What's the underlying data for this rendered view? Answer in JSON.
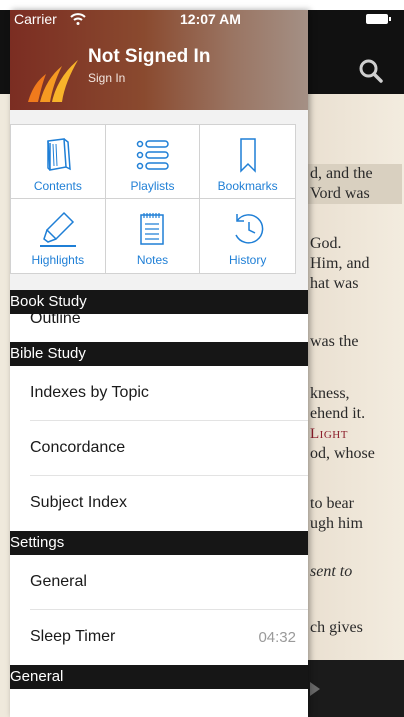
{
  "status_bar": {
    "carrier": "Carrier",
    "time": "12:07 AM"
  },
  "account": {
    "title": "Not Signed In",
    "subtitle": "Sign In"
  },
  "grid": [
    {
      "label": "Contents",
      "icon": "book-icon"
    },
    {
      "label": "Playlists",
      "icon": "playlist-icon"
    },
    {
      "label": "Bookmarks",
      "icon": "bookmark-icon"
    },
    {
      "label": "Highlights",
      "icon": "highlighter-icon"
    },
    {
      "label": "Notes",
      "icon": "notepad-icon"
    },
    {
      "label": "History",
      "icon": "history-icon"
    }
  ],
  "sections": {
    "book_study": {
      "title": "Book Study",
      "partial_item": "Outline"
    },
    "bible_study": {
      "title": "Bible Study",
      "items": [
        "Indexes by Topic",
        "Concordance",
        "Subject Index"
      ]
    },
    "settings": {
      "title": "Settings",
      "items": [
        "General",
        "Sleep Timer"
      ],
      "sleep_timer_value": "04:32"
    },
    "general": {
      "title": "General"
    }
  },
  "reader_text": [
    "d, and the",
    "Vord was",
    "God.",
    "Him, and",
    "hat was",
    "was the",
    "kness,",
    "ehend it.",
    "Light",
    "od, whose",
    "to bear",
    "ugh him",
    "sent to",
    "ch gives"
  ],
  "colors": {
    "accent": "#1f7fd6",
    "header_start": "#7b2d22",
    "section_bg": "#161616"
  }
}
